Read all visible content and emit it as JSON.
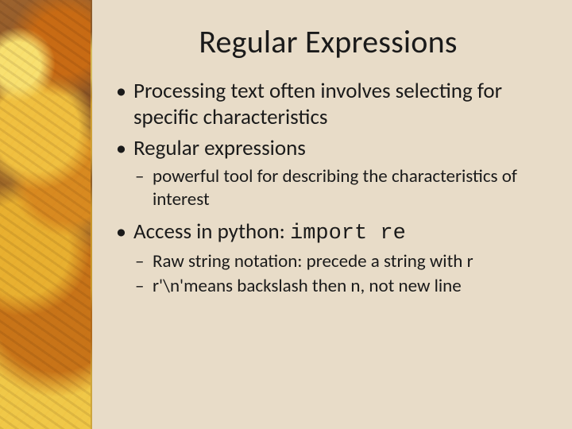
{
  "title": "Regular Expressions",
  "bullets": {
    "b1": "Processing text often involves selecting for specific characteristics",
    "b2": "Regular expressions",
    "b2_sub1": "powerful tool for describing the characteristics of interest",
    "b3_prefix": "Access in python: ",
    "b3_code": "import re",
    "b3_sub1": "Raw string notation: precede a string with r",
    "b3_sub2": "r'\\n'means backslash then n, not new line"
  }
}
